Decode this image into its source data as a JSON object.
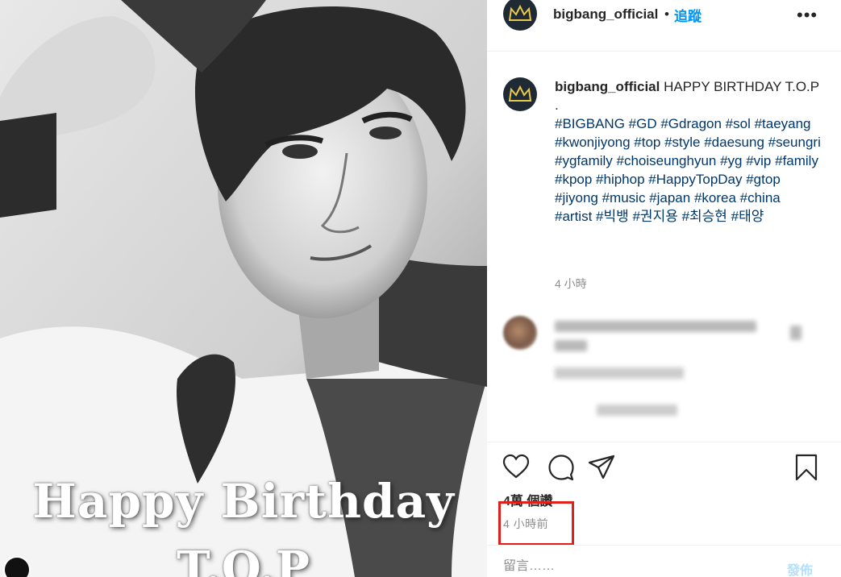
{
  "photo": {
    "title_line1": "Happy Birthday",
    "title_line2": "T.O.P"
  },
  "header": {
    "username": "bigbang_official",
    "separator": "•",
    "follow_label": "追蹤",
    "more_label": "•••"
  },
  "caption": {
    "username": "bigbang_official",
    "text": " HAPPY BIRTHDAY T.O.P",
    "dot": ".",
    "hashtags": "#BIGBANG #GD #Gdragon #sol #taeyang #kwonjiyong #top #style #daesung #seungri #ygfamily #choiseunghyun #yg #vip #family #kpop #hiphop #HappyTopDay #gtop #jiyong #music #japan #korea #china #artist #빅뱅 #권지용 #최승현 #태양",
    "time": "4 小時"
  },
  "actions": {
    "like_icon": "heart-icon",
    "comment_icon": "comment-icon",
    "share_icon": "share-icon",
    "save_icon": "bookmark-icon"
  },
  "stats": {
    "views": "4萬 個讚",
    "posted": "4 小時前"
  },
  "comment_box": {
    "placeholder": "留言……",
    "post_label": "發佈"
  },
  "colors": {
    "link": "#00376b",
    "accent": "#0095f6",
    "highlight": "#e0201b"
  }
}
